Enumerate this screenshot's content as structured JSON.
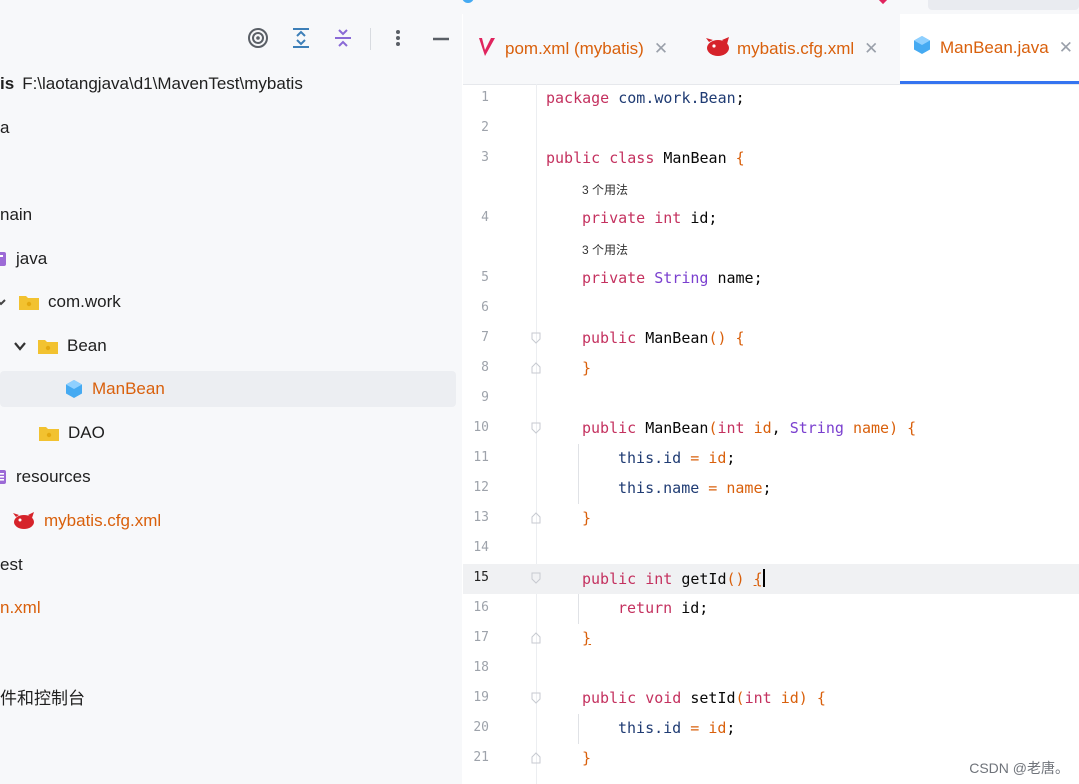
{
  "project": {
    "toolbar": {
      "icons": [
        "target-icon",
        "expand-all-icon",
        "collapse-all-icon",
        "more-vert-icon",
        "minimize-icon"
      ]
    },
    "rows": [
      {
        "label_bold": "is",
        "label": "F:\\laotangjava\\d1\\MavenTest\\mybatis"
      },
      {
        "label": "a"
      },
      {
        "label": ""
      },
      {
        "label": "nain"
      },
      {
        "label": "java"
      },
      {
        "label": "com.work"
      },
      {
        "label": "Bean"
      },
      {
        "label": "ManBean"
      },
      {
        "label": "DAO"
      },
      {
        "label": "resources"
      },
      {
        "label": "mybatis.cfg.xml"
      },
      {
        "label": "est"
      },
      {
        "label": "n.xml"
      },
      {
        "label": ""
      },
      {
        "label": "件和控制台"
      }
    ]
  },
  "tabs": [
    {
      "label": "pom.xml (mybatis)",
      "icon": "maven-icon"
    },
    {
      "label": "mybatis.cfg.xml",
      "icon": "mybatis-bird-icon"
    },
    {
      "label": "ManBean.java",
      "icon": "java-class-icon",
      "active": true
    }
  ],
  "editor": {
    "current_line": 15,
    "hint_usages": "3 个用法",
    "line_numbers": [
      "1",
      "2",
      "3",
      "4",
      "5",
      "6",
      "7",
      "8",
      "9",
      "10",
      "11",
      "12",
      "13",
      "14",
      "15",
      "16",
      "17",
      "18",
      "19",
      "20",
      "21"
    ],
    "code": {
      "l1_kw": "package",
      "l1_pkg": "com.work.Bean",
      "l1_semi": ";",
      "l3_kw": "public class",
      "l3_name": "ManBean",
      "l3_brace": "{",
      "l4_kw": "private",
      "l4_type": "int",
      "l4_name": "id;",
      "l5_kw": "private",
      "l5_type": "String",
      "l5_name": "name;",
      "l7_kw": "public",
      "l7_name": "ManBean",
      "l7_paren": "()",
      "l7_brace": "{",
      "l8_brace": "}",
      "l10_kw": "public",
      "l10_name": "ManBean",
      "l10_open": "(",
      "l10_t1": "int",
      "l10_p1": "id",
      "l10_comma": ",",
      "l10_t2": "String",
      "l10_p2": "name",
      "l10_close": ")",
      "l10_brace": "{",
      "l11_this": "this",
      "l11_field": ".id",
      "l11_eq": " = ",
      "l11_val": "id",
      "l11_semi": ";",
      "l12_this": "this",
      "l12_field": ".name",
      "l12_eq": " = ",
      "l12_val": "name",
      "l12_semi": ";",
      "l13_brace": "}",
      "l15_kw": "public",
      "l15_type": "int",
      "l15_name": "getId",
      "l15_paren": "()",
      "l15_brace": "{",
      "l16_kw": "return",
      "l16_val": "id;",
      "l17_brace": "}",
      "l19_kw": "public",
      "l19_type": "void",
      "l19_name": "setId",
      "l19_open": "(",
      "l19_t1": "int",
      "l19_p1": "id",
      "l19_close": ")",
      "l19_brace": "{",
      "l20_this": "this",
      "l20_field": ".id",
      "l20_eq": " = ",
      "l20_val": "id",
      "l20_semi": ";",
      "l21_brace": "}"
    }
  },
  "watermark": "CSDN @老唐。",
  "colors": {
    "keyword": "#c4315f",
    "type": "#7a3fcf",
    "param": "#d9600c",
    "accent": "#3574f0",
    "filename_modified": "#d9600c"
  }
}
